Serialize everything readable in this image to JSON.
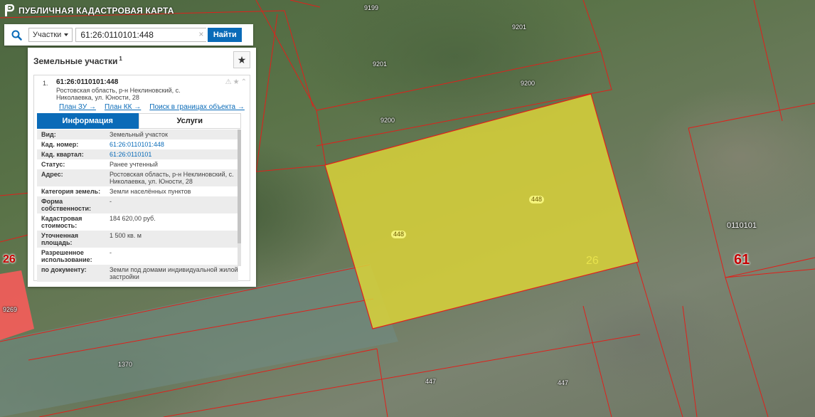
{
  "app": {
    "title": "ПУБЛИЧНАЯ КАДАСТРОВАЯ КАРТА"
  },
  "search": {
    "type_selected": "Участки",
    "query": "61:26:0110101:448",
    "clear_symbol": "×",
    "find_label": "Найти"
  },
  "panel": {
    "title": "Земельные участки",
    "count": "1",
    "result": {
      "index": "1.",
      "cad_number": "61:26:0110101:448",
      "address": "Ростовская область, р-н Неклиновский, с. Николаевка, ул. Юности, 28",
      "links": [
        "План ЗУ →",
        "План КК →",
        "Поиск в границах объекта →"
      ],
      "tabs": [
        "Информация",
        "Услуги"
      ],
      "rows": [
        {
          "label": "Вид:",
          "value": "Земельный участок"
        },
        {
          "label": "Кад. номер:",
          "value": "61:26:0110101:448"
        },
        {
          "label": "Кад. квартал:",
          "value": "61:26:0110101"
        },
        {
          "label": "Статус:",
          "value": "Ранее учтенный"
        },
        {
          "label": "Адрес:",
          "value": "Ростовская область, р-н Неклиновский, с. Николаевка, ул. Юности, 28"
        },
        {
          "label": "Категория земель:",
          "value": "Земли населённых пунктов"
        },
        {
          "label": "Форма собственности:",
          "value": "-"
        },
        {
          "label": "Кадастровая стоимость:",
          "value": "184 620,00 руб."
        },
        {
          "label": "Уточненная площадь:",
          "value": "1 500 кв. м"
        },
        {
          "label": "Разрешенное использование:",
          "value": "-"
        },
        {
          "label": "по документу:",
          "value": "Земли под домами индивидуальной жилой застройки"
        }
      ]
    }
  },
  "map": {
    "parcel_labels": [
      "9199",
      "9201",
      "9201",
      "9200",
      "9200",
      "9269",
      "1370",
      "447",
      "447"
    ],
    "selected_badges": [
      "448",
      "448"
    ],
    "quarter_label": "0110101",
    "district_left": "26",
    "district_right": "61",
    "district_selected": "26",
    "colors": {
      "boundary": "#e0201b",
      "selected_fill": "#d9d23a",
      "accent": "#0a6bb8"
    }
  }
}
